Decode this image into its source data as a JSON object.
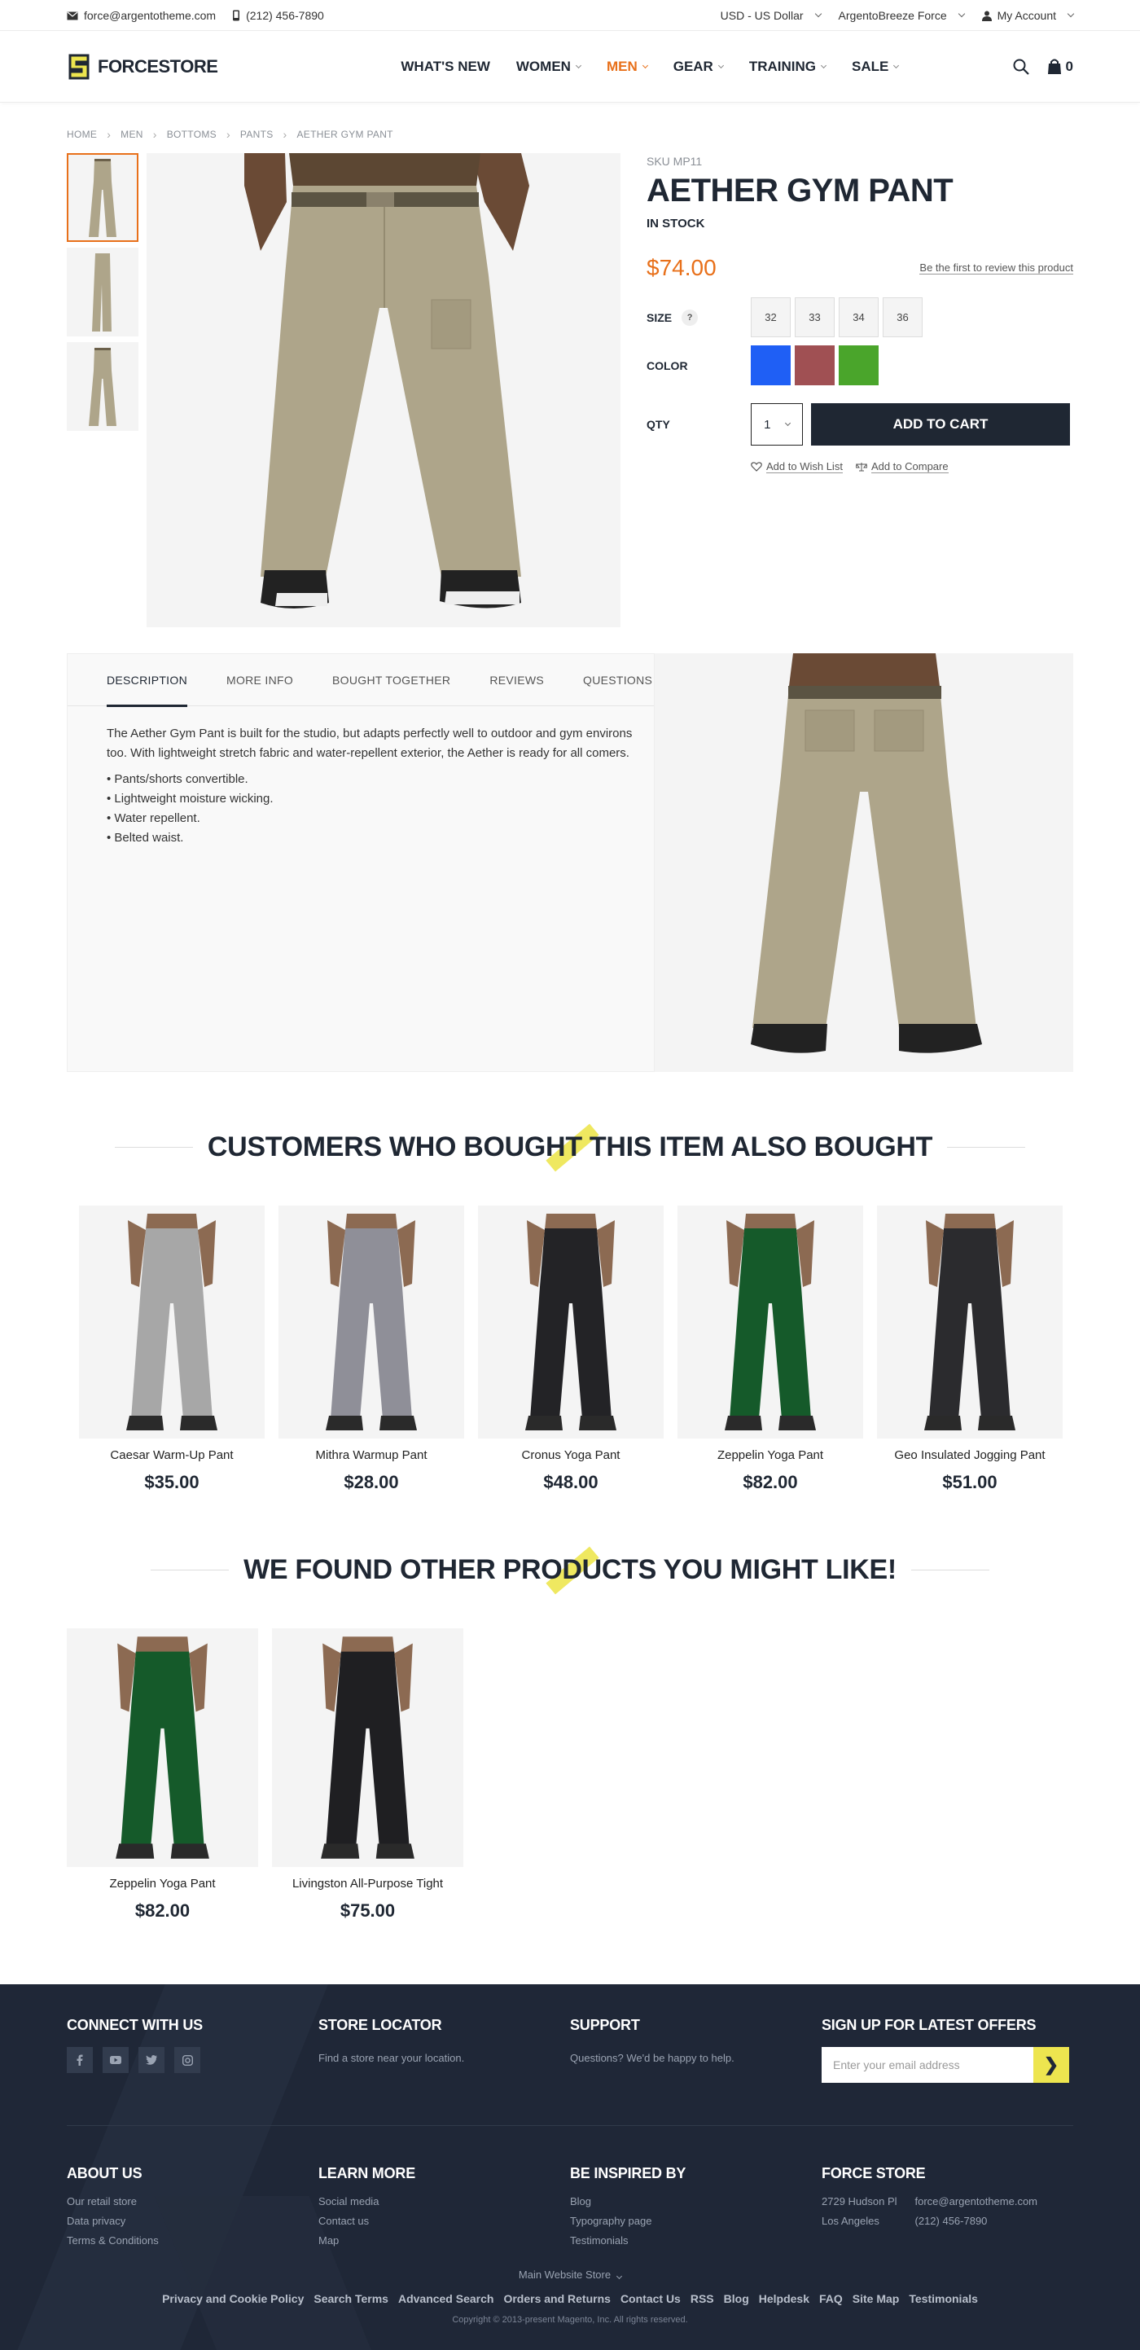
{
  "topbar": {
    "email": "force@argentotheme.com",
    "phone": "(212) 456-7890",
    "currency": "USD - US Dollar",
    "store": "ArgentoBreeze Force",
    "account": "My Account"
  },
  "header": {
    "logo_text": "FORCESTORE",
    "nav": [
      "WHAT'S NEW",
      "WOMEN",
      "MEN",
      "GEAR",
      "TRAINING",
      "SALE"
    ],
    "cart_count": "0"
  },
  "breadcrumb": [
    "HOME",
    "MEN",
    "BOTTOMS",
    "PANTS",
    "AETHER GYM PANT"
  ],
  "product": {
    "sku": "SKU MP11",
    "title": "AETHER GYM PANT",
    "stock": "IN STOCK",
    "price": "$74.00",
    "review_link": "Be the first to review this product",
    "size_label": "SIZE",
    "size_help": "?",
    "sizes": [
      "32",
      "33",
      "34",
      "36"
    ],
    "color_label": "COLOR",
    "colors": [
      "#1f5ff5",
      "#a05053",
      "#4aa52b"
    ],
    "qty_label": "QTY",
    "qty_value": "1",
    "add_to_cart": "ADD TO CART",
    "wishlist": "Add to Wish List",
    "compare": "Add to Compare",
    "pant_color": "#aea58a"
  },
  "tabs": {
    "items": [
      "DESCRIPTION",
      "MORE INFO",
      "BOUGHT TOGETHER",
      "REVIEWS",
      "QUESTIONS"
    ],
    "description": "The Aether Gym Pant is built for the studio, but adapts perfectly well to outdoor and gym environs too. With lightweight stretch fabric and water-repellent exterior, the Aether is ready for all comers.",
    "bullets": [
      "• Pants/shorts convertible.",
      "• Lightweight moisture wicking.",
      "• Water repellent.",
      "• Belted waist."
    ]
  },
  "also_bought": {
    "heading": "CUSTOMERS WHO BOUGHT THIS ITEM ALSO BOUGHT",
    "items": [
      {
        "name": "Caesar Warm-Up Pant",
        "price": "$35.00",
        "color": "#a7a7a7"
      },
      {
        "name": "Mithra Warmup Pant",
        "price": "$28.00",
        "color": "#8f8f98"
      },
      {
        "name": "Cronus Yoga Pant",
        "price": "$48.00",
        "color": "#232326"
      },
      {
        "name": "Zeppelin Yoga Pant",
        "price": "$82.00",
        "color": "#155a2a"
      },
      {
        "name": "Geo Insulated Jogging Pant",
        "price": "$51.00",
        "color": "#2b2b2e"
      }
    ]
  },
  "might_like": {
    "heading": "WE FOUND OTHER PRODUCTS YOU MIGHT LIKE!",
    "items": [
      {
        "name": "Zeppelin Yoga Pant",
        "price": "$82.00",
        "color": "#155a2a"
      },
      {
        "name": "Livingston All-Purpose Tight",
        "price": "$75.00",
        "color": "#1f1f22"
      }
    ]
  },
  "footer": {
    "connect": "CONNECT WITH US",
    "locator_title": "STORE LOCATOR",
    "locator_text": "Find a store near your location.",
    "support_title": "SUPPORT",
    "support_text": "Questions? We'd be happy to help.",
    "signup_title": "SIGN UP FOR LATEST OFFERS",
    "signup_placeholder": "Enter your email address",
    "signup_button": "❯",
    "about_title": "ABOUT US",
    "about_links": [
      "Our retail store",
      "Data privacy",
      "Terms & Conditions"
    ],
    "learn_title": "LEARN MORE",
    "learn_links": [
      "Social media",
      "Contact us",
      "Map"
    ],
    "inspired_title": "BE INSPIRED BY",
    "inspired_links": [
      "Blog",
      "Typography page",
      "Testimonials"
    ],
    "force_title": "FORCE STORE",
    "force_addr1": "2729 Hudson Pl",
    "force_addr2": "Los Angeles",
    "force_email": "force@argentotheme.com",
    "force_phone": "(212) 456-7890",
    "store_switch": "Main Website Store",
    "bottom_links": [
      "Privacy and Cookie Policy",
      "Search Terms",
      "Advanced Search",
      "Orders and Returns",
      "Contact Us",
      "RSS",
      "Blog",
      "Helpdesk",
      "FAQ",
      "Site Map",
      "Testimonials"
    ],
    "copyright": "Copyright © 2013-present Magento, Inc. All rights reserved."
  }
}
